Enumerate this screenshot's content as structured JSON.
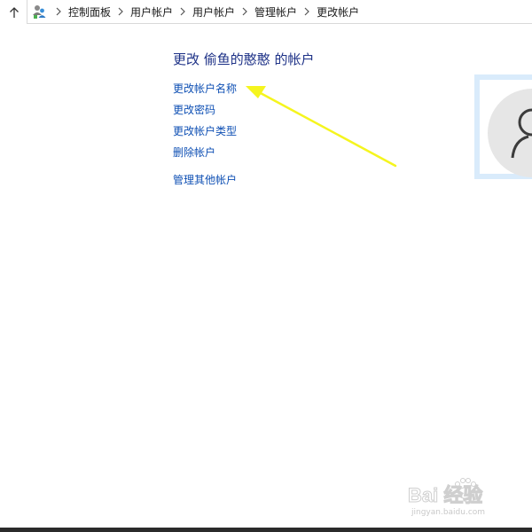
{
  "breadcrumb": {
    "items": [
      "控制面板",
      "用户帐户",
      "用户帐户",
      "管理帐户",
      "更改帐户"
    ]
  },
  "main": {
    "title": "更改 偷鱼的憨憨 的帐户",
    "tasks": [
      {
        "label": "更改帐户名称"
      },
      {
        "label": "更改密码"
      },
      {
        "label": "更改帐户类型"
      },
      {
        "label": "删除帐户"
      }
    ],
    "manage_other": "管理其他帐户"
  },
  "annotation": {
    "color": "#f5f51e",
    "target": "更改帐户名称"
  },
  "watermark": {
    "text": "Bai 经验",
    "sub": "jingyan.baidu.com"
  },
  "colors": {
    "title": "#1e3287",
    "link": "#0f50b4",
    "avatar_frame": "#d9ebfb"
  },
  "icons": {
    "up": "up-arrow-icon",
    "control_panel": "control-panel-users-icon",
    "separator": "chevron-right-icon",
    "avatar": "user-silhouette-icon"
  }
}
